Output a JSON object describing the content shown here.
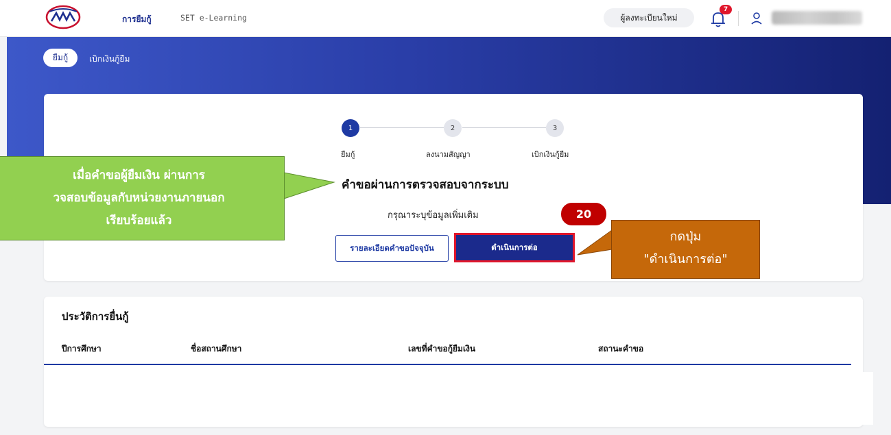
{
  "topnav": {
    "loan_link": "การยืมกู้",
    "elearning_link": "SET e-Learning",
    "register_button": "ผู้ลงทะเบียนใหม่",
    "notification_count": "7"
  },
  "banner": {
    "tabs": [
      {
        "label": "ยืมกู้",
        "active": true
      },
      {
        "label": "เบิกเงินกู้ยืม",
        "active": false
      }
    ]
  },
  "stepper": {
    "steps": [
      {
        "number": "1",
        "label": "ยืมกู้",
        "active": true
      },
      {
        "number": "2",
        "label": "ลงนามสัญญา",
        "active": false
      },
      {
        "number": "3",
        "label": "เบิกเงินกู้ยืม",
        "active": false
      }
    ]
  },
  "status": {
    "title": "คำขอผ่านการตรวจสอบจากระบบ",
    "subtitle": "กรุณาระบุข้อมูลเพิ่มเติม",
    "detail_button": "รายละเอียดคำขอปัจจุบัน",
    "continue_button": "ดำเนินการต่อ"
  },
  "history": {
    "title": "ประวัติการยื่นกู้",
    "columns": [
      "ปีการศึกษา",
      "ชื่อสถานศึกษา",
      "เลขที่คำขอกู้ยืมเงิน",
      "สถานะคำขอ"
    ]
  },
  "annotations": {
    "green_callout": [
      "เมื่อคำขอผู้ยืมเงิน ผ่านการ",
      "วจสอบข้อมูลกับหน่วยงานภายนอก",
      "เรียบร้อยแล้ว"
    ],
    "step_number": "20",
    "orange_callout": [
      "กดปุ่ม",
      "\"ดำเนินการต่อ\""
    ]
  },
  "colors": {
    "brand": "#1e3aa3",
    "highlight": "#e0162b",
    "green_callout": "#92d050",
    "orange_callout": "#c5680a"
  }
}
